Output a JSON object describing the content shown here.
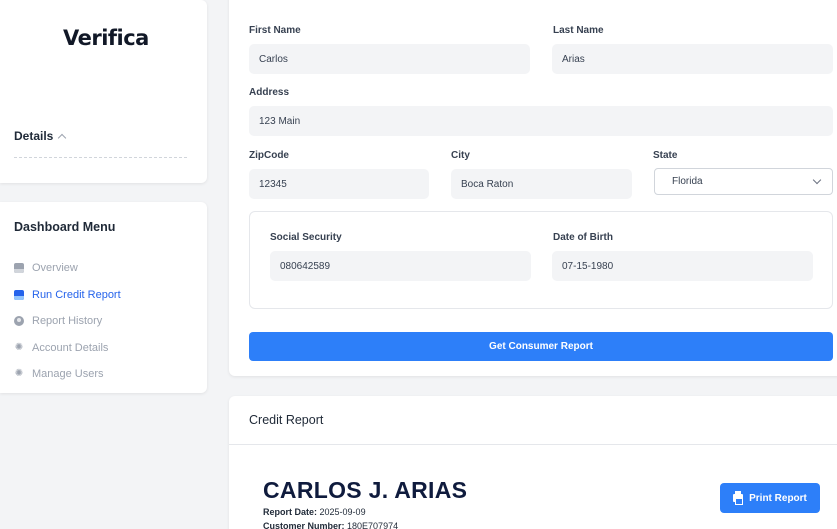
{
  "brand": {
    "logo_text": "Verifica"
  },
  "details": {
    "label": "Details"
  },
  "menu": {
    "title": "Dashboard Menu",
    "items": [
      {
        "label": "Overview",
        "icon": "panel-icon",
        "active": false
      },
      {
        "label": "Run Credit Report",
        "icon": "panel-icon",
        "active": true
      },
      {
        "label": "Report History",
        "icon": "user-icon",
        "active": false
      },
      {
        "label": "Account Details",
        "icon": "gear-icon",
        "active": false
      },
      {
        "label": "Manage Users",
        "icon": "gear-icon",
        "active": false
      }
    ]
  },
  "form": {
    "first_name": {
      "label": "First Name",
      "value": "Carlos"
    },
    "last_name": {
      "label": "Last Name",
      "value": "Arias"
    },
    "address": {
      "label": "Address",
      "value": "123 Main"
    },
    "zipcode": {
      "label": "ZipCode",
      "value": "12345"
    },
    "city": {
      "label": "City",
      "value": "Boca Raton"
    },
    "state": {
      "label": "State",
      "value": "Florida"
    },
    "ssn": {
      "label": "Social Security",
      "value": "080642589"
    },
    "dob": {
      "label": "Date of Birth",
      "value": "07-15-1980"
    },
    "submit_label": "Get Consumer Report"
  },
  "report": {
    "section_title": "Credit Report",
    "name": "CARLOS J. ARIAS",
    "report_date_label": "Report Date:",
    "report_date": "2025-09-09",
    "customer_number_label": "Customer Number:",
    "customer_number": "180E707974",
    "print_label": "Print Report"
  },
  "colors": {
    "accent": "#2d7ff9",
    "active_menu": "#2563eb",
    "page_bg": "#f3f4f6"
  }
}
